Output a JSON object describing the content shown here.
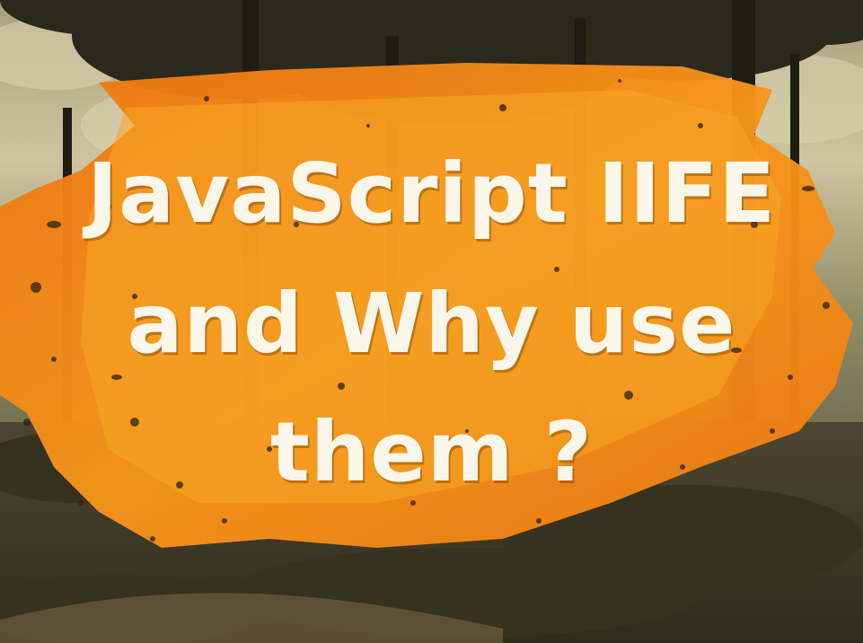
{
  "headline": {
    "line1": "JavaScript IIFE",
    "line2": "and Why use",
    "line3": "them ?"
  },
  "colors": {
    "sky": "#c9bf97",
    "trees": "#2b2a1c",
    "ground": "#4a4530",
    "brush_orange": "#f07e10",
    "brush_light": "#f7a11c",
    "text": "#fbf6ea"
  }
}
